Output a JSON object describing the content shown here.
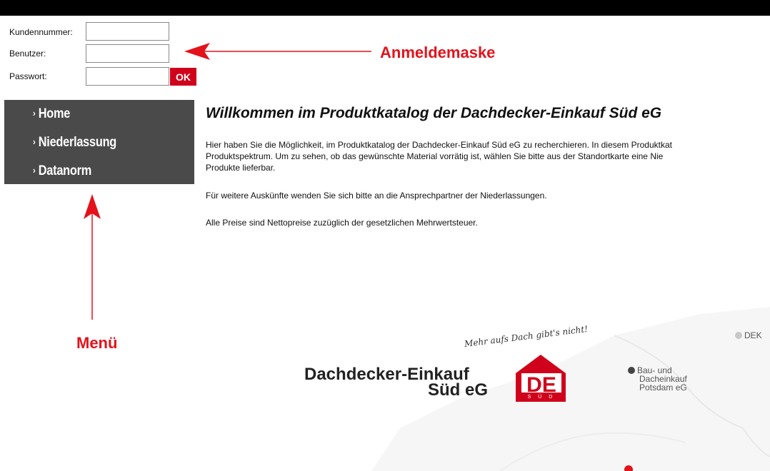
{
  "login": {
    "customer_number_label": "Kundennummer:",
    "user_label": "Benutzer:",
    "password_label": "Passwort:",
    "ok_label": "OK"
  },
  "menu": {
    "items": [
      {
        "label": "Home"
      },
      {
        "label": "Niederlassung"
      },
      {
        "label": "Datanorm"
      }
    ]
  },
  "main": {
    "title": "Willkommen im Produktkatalog der Dachdecker-Einkauf Süd eG",
    "paragraphs": [
      "Hier haben Sie die Möglichkeit, im Produktkatalog der Dachdecker-Einkauf Süd eG zu recherchieren. In diesem Produktkat",
      "Produktspektrum. Um zu sehen, ob das gewünschte Material vorrätig ist, wählen Sie bitte aus der Standortkarte eine Nie",
      "Produkte lieferbar.",
      "Für weitere Auskünfte wenden Sie sich bitte an die Ansprechpartner der Niederlassungen.",
      "Alle Preise sind Nettopreise zuzüglich der gesetzlichen Mehrwertsteuer."
    ]
  },
  "annotations": {
    "login_mask": "Anmeldemaske",
    "menu": "Menü"
  },
  "branding": {
    "slogan": "Mehr aufs Dach gibt's nicht!",
    "company_line1": "Dachdecker-Einkauf",
    "company_line2": "Süd eG",
    "logo_letters": "DE",
    "logo_sub": "S Ü D"
  },
  "map": {
    "locations": [
      {
        "label": "DEK",
        "dot_color": "#c8c8c8"
      },
      {
        "label_lines": [
          "Bau- und",
          "Dacheinkauf",
          "Potsdam eG"
        ],
        "dot_color": "#444444"
      }
    ],
    "marker_color": "#e3121b"
  },
  "colors": {
    "accent_red": "#d0021b",
    "annotation_red": "#e3121b",
    "menu_bg": "#4a4a4a",
    "top_bar": "#000000"
  }
}
